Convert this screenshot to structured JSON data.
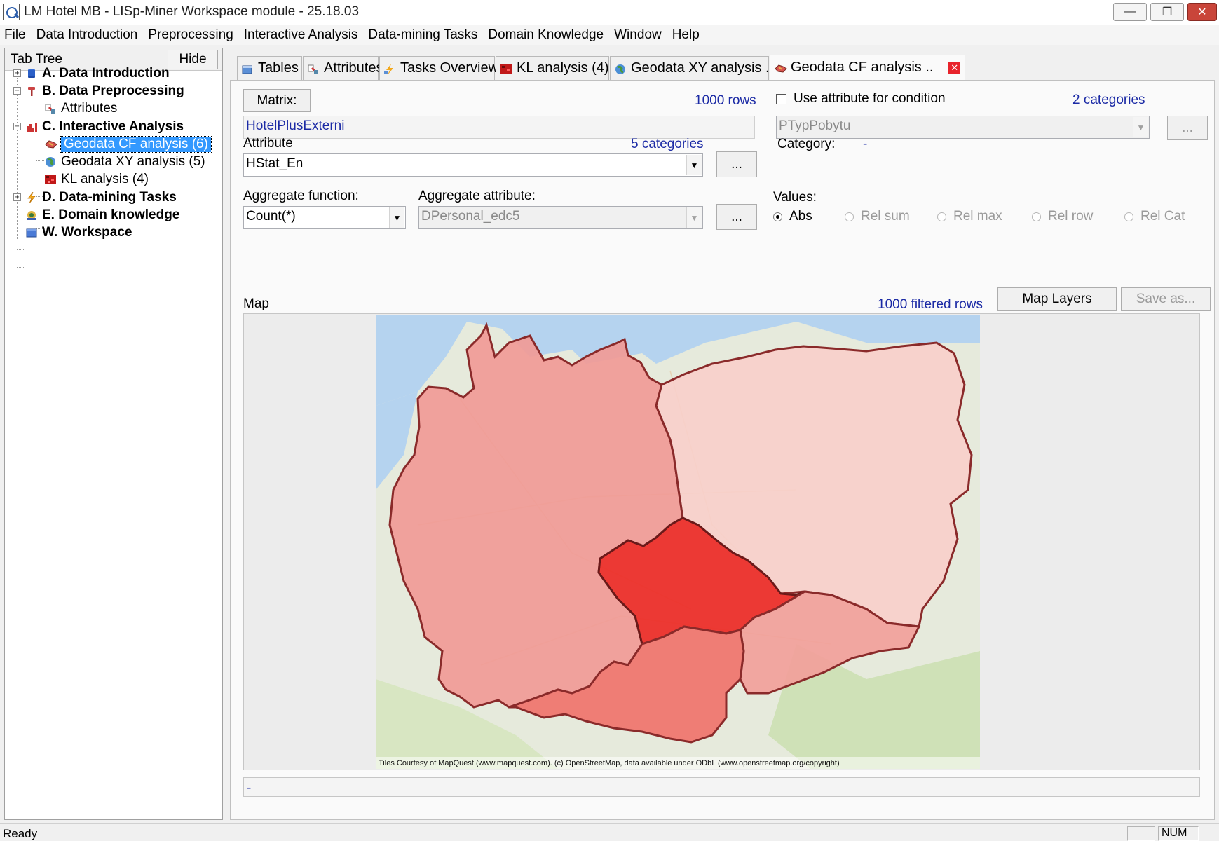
{
  "window": {
    "title": "LM Hotel MB - LISp-Miner Workspace module - 25.18.03",
    "minimize_glyph": "—",
    "restore_glyph": "❐",
    "close_glyph": "✕"
  },
  "menu": [
    "File",
    "Data Introduction",
    "Preprocessing",
    "Interactive Analysis",
    "Data-mining Tasks",
    "Domain Knowledge",
    "Window",
    "Help"
  ],
  "left_panel": {
    "title": "Tab Tree",
    "hide_label": "Hide",
    "tree": [
      {
        "label": "A. Data Introduction",
        "icon": "database-icon"
      },
      {
        "label": "B. Data Preprocessing",
        "icon": "tools-icon"
      },
      {
        "label": "Attributes",
        "icon": "attributes-icon"
      },
      {
        "label": "C. Interactive Analysis",
        "icon": "bar-chart-icon"
      },
      {
        "label": "Geodata CF analysis (6)",
        "icon": "map-icon"
      },
      {
        "label": "Geodata XY analysis (5)",
        "icon": "globe-icon"
      },
      {
        "label": "KL analysis (4)",
        "icon": "grid-icon"
      },
      {
        "label": "D. Data-mining Tasks",
        "icon": "lightning-icon"
      },
      {
        "label": "E. Domain knowledge",
        "icon": "knowledge-icon"
      },
      {
        "label": "W. Workspace",
        "icon": "workspace-icon"
      }
    ]
  },
  "tabs": [
    {
      "label": "Tables",
      "icon": "tables-icon"
    },
    {
      "label": "Attributes",
      "icon": "attributes-icon"
    },
    {
      "label": "Tasks Overview",
      "icon": "tasks-icon"
    },
    {
      "label": "KL analysis (4)",
      "icon": "grid-icon"
    },
    {
      "label": "Geodata XY analysis ..",
      "icon": "globe-icon"
    },
    {
      "label": "Geodata CF analysis ..",
      "icon": "map-icon"
    }
  ],
  "tab_close_glyph": "✕",
  "form": {
    "matrix_button": "Matrix:",
    "rows_count": "1000 rows",
    "matrix_value": "HotelPlusExterni",
    "use_condition_label": "Use attribute for condition",
    "condition_categories": "2 categories",
    "condition_attribute": "PTypPobytu",
    "dots": "...",
    "attribute_label": "Attribute",
    "attribute_categories": "5 categories",
    "attribute_value": "HStat_En",
    "category_label": "Category:",
    "category_value": "-",
    "aggregate_function_label": "Aggregate function:",
    "aggregate_function_value": "Count(*)",
    "aggregate_attribute_label": "Aggregate attribute:",
    "aggregate_attribute_value": "DPersonal_edc5",
    "values_label": "Values:",
    "value_options": [
      "Abs",
      "Rel sum",
      "Rel max",
      "Rel row",
      "Rel Cat"
    ],
    "selected_value_option": "Abs",
    "map_label": "Map",
    "filtered_rows": "1000 filtered rows",
    "map_layers_button": "Map Layers",
    "save_as_button": "Save as...",
    "status_value": "-"
  },
  "map": {
    "attribution": "Tiles Courtesy of MapQuest (www.mapquest.com). (c) OpenStreetMap, data available under ODbL (www.openstreetmap.org/copyright)",
    "region_colors": {
      "germany": "#f19a96",
      "poland": "#f8cfca",
      "czechia": "#ec2f2a",
      "austria": "#f0736b",
      "slovakia": "#f2a09a"
    }
  },
  "statusbar": {
    "left": "Ready",
    "num": "NUM"
  }
}
